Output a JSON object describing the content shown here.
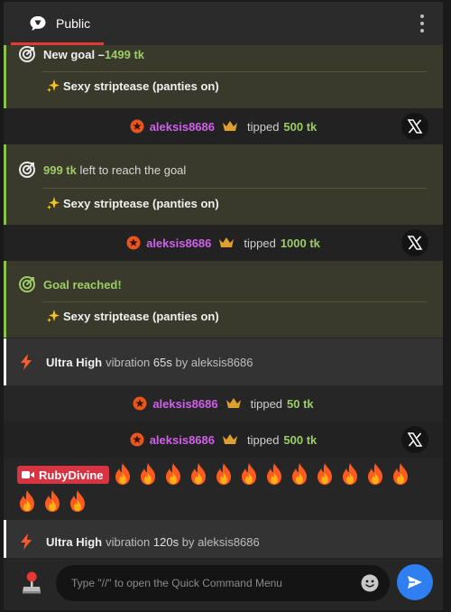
{
  "header": {
    "tab_label": "Public",
    "menu_icon": "vertical-dots-icon"
  },
  "feed": {
    "goal_new": {
      "prefix": "New goal – ",
      "amount": "1499 tk",
      "description": "Sexy striptease (panties on)"
    },
    "tip_1": {
      "user": "aleksis8686",
      "verb": "tipped",
      "amount": "500 tk"
    },
    "goal_progress": {
      "amount": "999 tk",
      "suffix": " left to reach the goal",
      "description": "Sexy striptease (panties on)"
    },
    "tip_2": {
      "user": "aleksis8686",
      "verb": "tipped",
      "amount": "1000 tk"
    },
    "goal_reached": {
      "title": "Goal reached!",
      "description": "Sexy striptease (panties on)"
    },
    "vibration_1": {
      "level": "Ultra High",
      "word": "vibration",
      "duration": "65s",
      "by": "by",
      "user": "aleksis8686"
    },
    "tip_3": {
      "user": "aleksis8686",
      "verb": "tipped",
      "amount": "50 tk"
    },
    "tip_4": {
      "user": "aleksis8686",
      "verb": "tipped",
      "amount": "500 tk"
    },
    "fire_message": {
      "badge_name": "RubyDivine",
      "fire_count": 15
    },
    "vibration_2": {
      "level": "Ultra High",
      "word": "vibration",
      "duration": "120s",
      "by": "by",
      "user": "aleksis8686"
    }
  },
  "footer": {
    "input_placeholder": "Type \"//\" to open the Quick Command Menu"
  },
  "colors": {
    "accent_red": "#e53935",
    "goal_green": "#9ccc65",
    "tipper_purple": "#d060ea",
    "crown_gold": "#e0a030",
    "send_blue": "#2f7ff0",
    "badge_red": "#d63442"
  }
}
